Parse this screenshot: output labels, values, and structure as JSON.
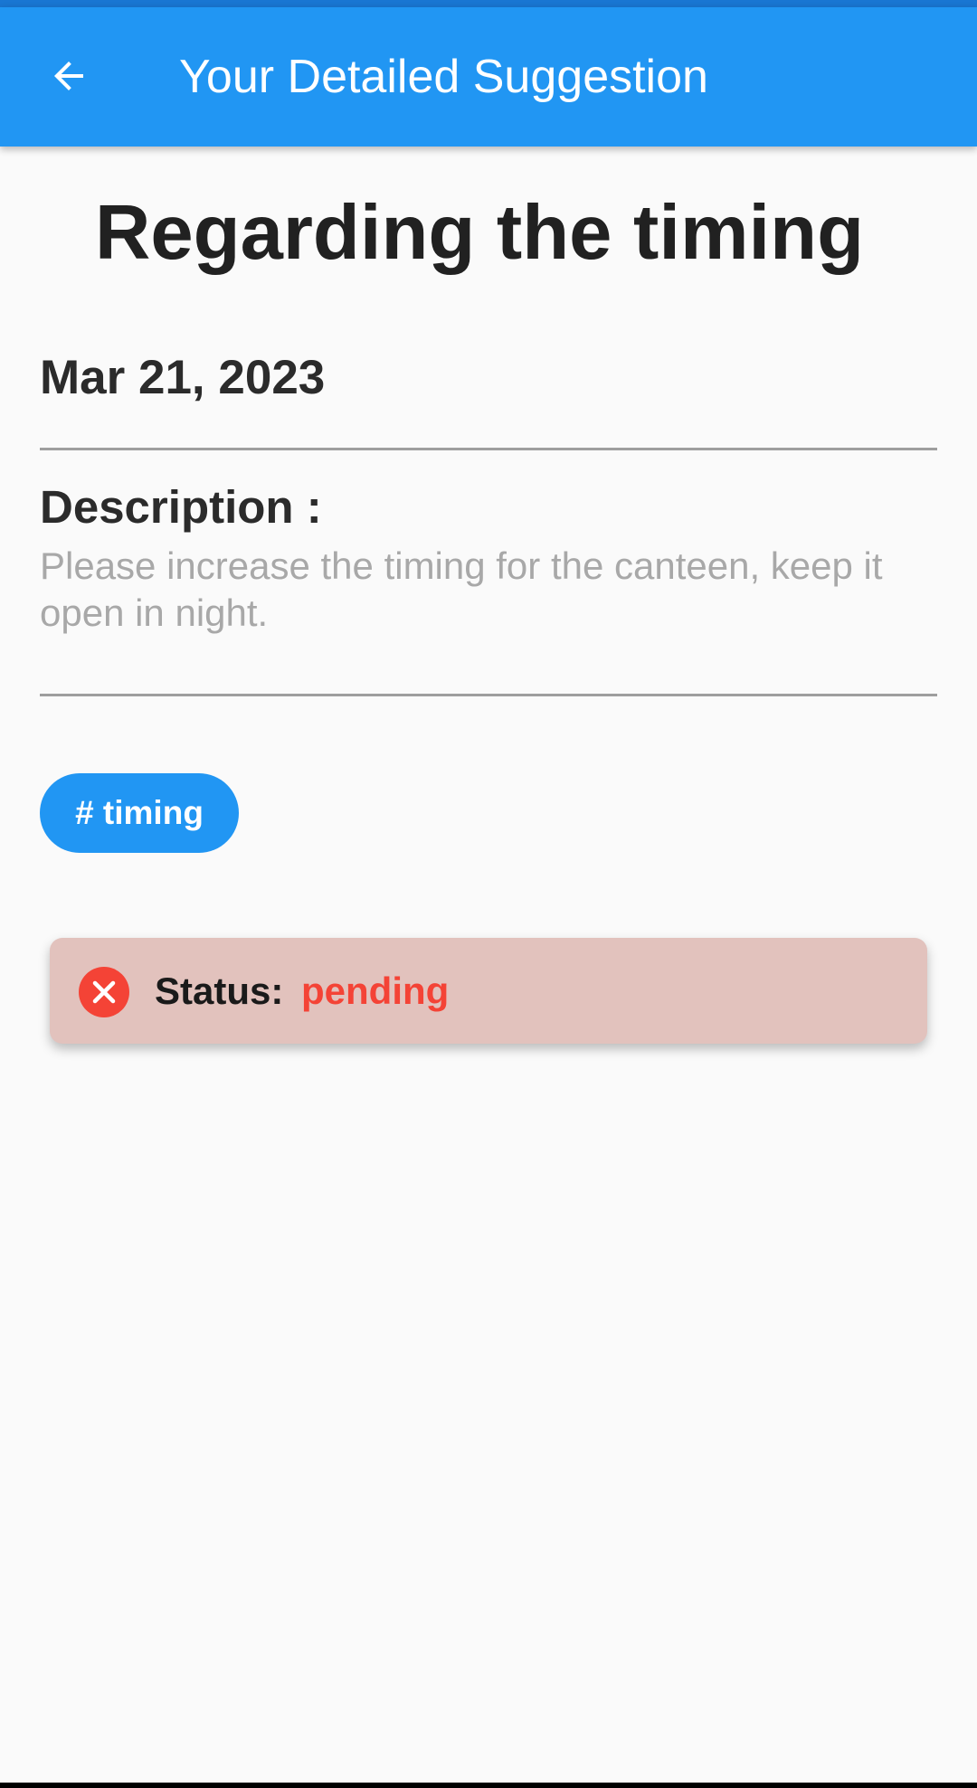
{
  "app_bar": {
    "title": "Your Detailed Suggestion",
    "back_icon": "arrow-back-icon"
  },
  "suggestion": {
    "title": "Regarding the timing",
    "date": "Mar 21, 2023",
    "description_label": "Description :",
    "description": "Please increase the timing for the canteen, keep it open in night.",
    "tag": "# timing"
  },
  "status": {
    "label": "Status:",
    "value": "pending",
    "icon": "cancel-circle-icon"
  },
  "colors": {
    "primary": "#2196f3",
    "status_pending": "#f44336",
    "status_card_bg": "#e2c2bd"
  }
}
